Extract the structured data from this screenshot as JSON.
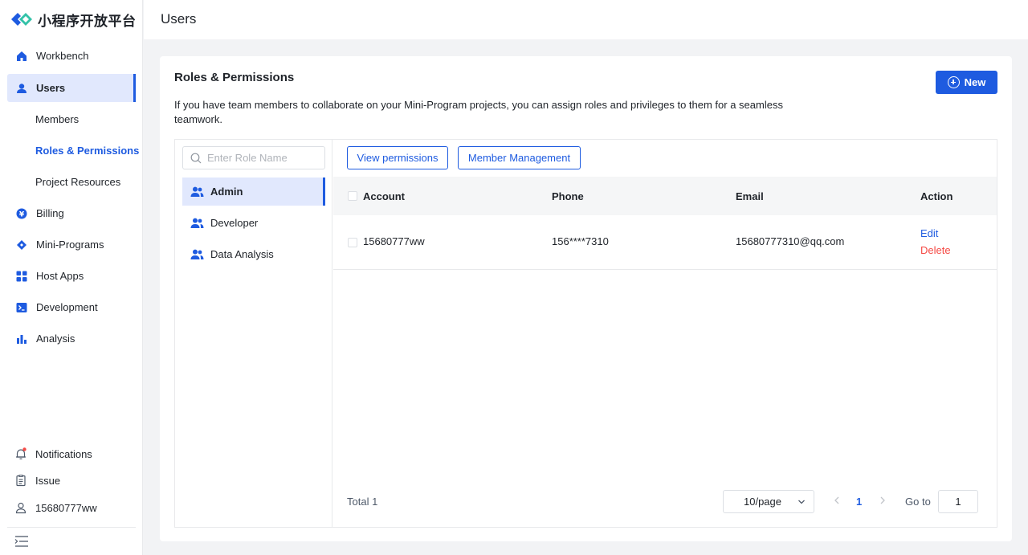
{
  "brand": {
    "name": "小程序开放平台",
    "accent": "#1e5be0"
  },
  "sidebar": {
    "items": [
      {
        "label": "Workbench",
        "icon": "home-icon"
      },
      {
        "label": "Users",
        "icon": "user-icon",
        "active": true
      },
      {
        "label": "Billing",
        "icon": "yen-icon"
      },
      {
        "label": "Mini-Programs",
        "icon": "diamond-icon"
      },
      {
        "label": "Host Apps",
        "icon": "grid-icon"
      },
      {
        "label": "Development",
        "icon": "terminal-icon"
      },
      {
        "label": "Analysis",
        "icon": "bar-chart-icon"
      }
    ],
    "sub_items": [
      {
        "label": "Members"
      },
      {
        "label": "Roles & Permissions",
        "active": true
      },
      {
        "label": "Project Resources"
      }
    ],
    "bottom": {
      "notifications": "Notifications",
      "issue": "Issue",
      "user": "15680777ww"
    }
  },
  "header": {
    "title": "Users"
  },
  "card": {
    "title": "Roles & Permissions",
    "description": "If you have team members to collaborate on your Mini-Program projects, you can assign roles and privileges to them for a seamless teamwork.",
    "new_button": "New"
  },
  "roles": {
    "search_placeholder": "Enter Role Name",
    "items": [
      {
        "label": "Admin",
        "active": true
      },
      {
        "label": "Developer"
      },
      {
        "label": "Data Analysis"
      }
    ]
  },
  "toolbar": {
    "view_permissions": "View permissions",
    "member_management": "Member Management"
  },
  "table": {
    "columns": [
      "Account",
      "Phone",
      "Email",
      "Action"
    ],
    "rows": [
      {
        "account": "15680777ww",
        "phone": "156****7310",
        "email": "15680777310@qq.com",
        "edit": "Edit",
        "delete": "Delete"
      }
    ]
  },
  "pagination": {
    "total": "Total 1",
    "page_size": "10/page",
    "current_page": "1",
    "goto_label": "Go to",
    "goto_value": "1"
  }
}
